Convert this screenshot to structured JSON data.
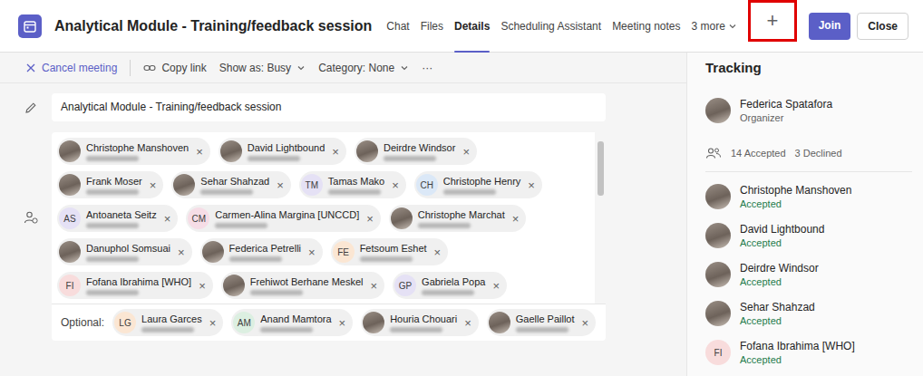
{
  "window": {
    "title": "Analytical Module - Training/feedback session"
  },
  "tabs": [
    {
      "label": "Chat",
      "selected": false
    },
    {
      "label": "Files",
      "selected": false
    },
    {
      "label": "Details",
      "selected": true
    },
    {
      "label": "Scheduling Assistant",
      "selected": false
    },
    {
      "label": "Meeting notes",
      "selected": false
    }
  ],
  "more_tab": {
    "label": "3 more"
  },
  "add_tab": {
    "label": "+",
    "highlighted": true
  },
  "buttons": [
    {
      "label": "Join",
      "primary": true
    },
    {
      "label": "Close",
      "primary": false
    }
  ],
  "toolbar": [
    {
      "label": "Cancel meeting",
      "kind": "cancel"
    },
    {
      "label": "Copy link",
      "kind": "link"
    },
    {
      "label": "Show as: Busy",
      "kind": "dropdown"
    },
    {
      "label": "Category: None",
      "kind": "dropdown"
    },
    {
      "label": "···",
      "kind": "more"
    }
  ],
  "title_field": {
    "value": "Analytical Module - Training/feedback session"
  },
  "remove_icon": "×",
  "attendees": {
    "rows": [
      [
        {
          "name": "Christophe Manshoven",
          "avatar": {
            "kind": "photo"
          }
        },
        {
          "name": "David Lightbound",
          "avatar": {
            "kind": "photo"
          }
        },
        {
          "name": "Deirdre Windsor",
          "avatar": {
            "kind": "photo"
          }
        }
      ],
      [
        {
          "name": "Frank Moser",
          "avatar": {
            "kind": "photo"
          }
        },
        {
          "name": "Sehar Shahzad",
          "avatar": {
            "kind": "photo"
          }
        },
        {
          "name": "Tamas Mako",
          "avatar": {
            "kind": "initials",
            "initials": "TM",
            "color": "#e5e1f5"
          }
        },
        {
          "name": "Christophe Henry",
          "avatar": {
            "kind": "initials",
            "initials": "CH",
            "color": "#dbe8f7"
          }
        }
      ],
      [
        {
          "name": "Antoaneta Seitz",
          "avatar": {
            "kind": "initials",
            "initials": "AS",
            "color": "#e5e1f5"
          }
        },
        {
          "name": "Carmen-Alina Margina [UNCCD]",
          "avatar": {
            "kind": "initials",
            "initials": "CM",
            "color": "#f6dde6"
          }
        },
        {
          "name": "Christophe Marchat",
          "avatar": {
            "kind": "photo"
          }
        }
      ],
      [
        {
          "name": "Danuphol Somsuai",
          "avatar": {
            "kind": "photo"
          }
        },
        {
          "name": "Federica Petrelli",
          "avatar": {
            "kind": "photo"
          }
        },
        {
          "name": "Fetsoum Eshet",
          "avatar": {
            "kind": "initials",
            "initials": "FE",
            "color": "#fbe6d3"
          }
        }
      ],
      [
        {
          "name": "Fofana Ibrahima [WHO]",
          "avatar": {
            "kind": "initials",
            "initials": "FI",
            "color": "#f8dcdc"
          }
        },
        {
          "name": "Frehiwot Berhane Meskel",
          "avatar": {
            "kind": "photo"
          }
        },
        {
          "name": "Gabriela Popa",
          "avatar": {
            "kind": "initials",
            "initials": "GP",
            "color": "#e5e1f5"
          }
        }
      ]
    ],
    "optional_label": "Optional:",
    "optional": [
      {
        "name": "Laura Garces",
        "avatar": {
          "kind": "initials",
          "initials": "LG",
          "color": "#fbe6d3"
        }
      },
      {
        "name": "Anand Mamtora",
        "avatar": {
          "kind": "initials",
          "initials": "AM",
          "color": "#dcefe1"
        }
      },
      {
        "name": "Houria Chouari",
        "avatar": {
          "kind": "photo"
        }
      },
      {
        "name": "Gaelle Paillot",
        "avatar": {
          "kind": "photo"
        }
      }
    ]
  },
  "tracking": {
    "title": "Tracking",
    "organizer": {
      "name": "Federica Spatafora",
      "role": "Organizer",
      "avatar": {
        "kind": "photo"
      }
    },
    "summary": [
      "14 Accepted",
      "3 Declined"
    ],
    "responses": [
      {
        "name": "Christophe Manshoven",
        "status": "Accepted",
        "avatar": {
          "kind": "photo"
        }
      },
      {
        "name": "David Lightbound",
        "status": "Accepted",
        "avatar": {
          "kind": "photo"
        }
      },
      {
        "name": "Deirdre Windsor",
        "status": "Accepted",
        "avatar": {
          "kind": "photo"
        }
      },
      {
        "name": "Sehar Shahzad",
        "status": "Accepted",
        "avatar": {
          "kind": "photo"
        }
      },
      {
        "name": "Fofana Ibrahima [WHO]",
        "status": "Accepted",
        "avatar": {
          "kind": "initials",
          "initials": "FI",
          "color": "#f8dcdc"
        }
      }
    ]
  }
}
